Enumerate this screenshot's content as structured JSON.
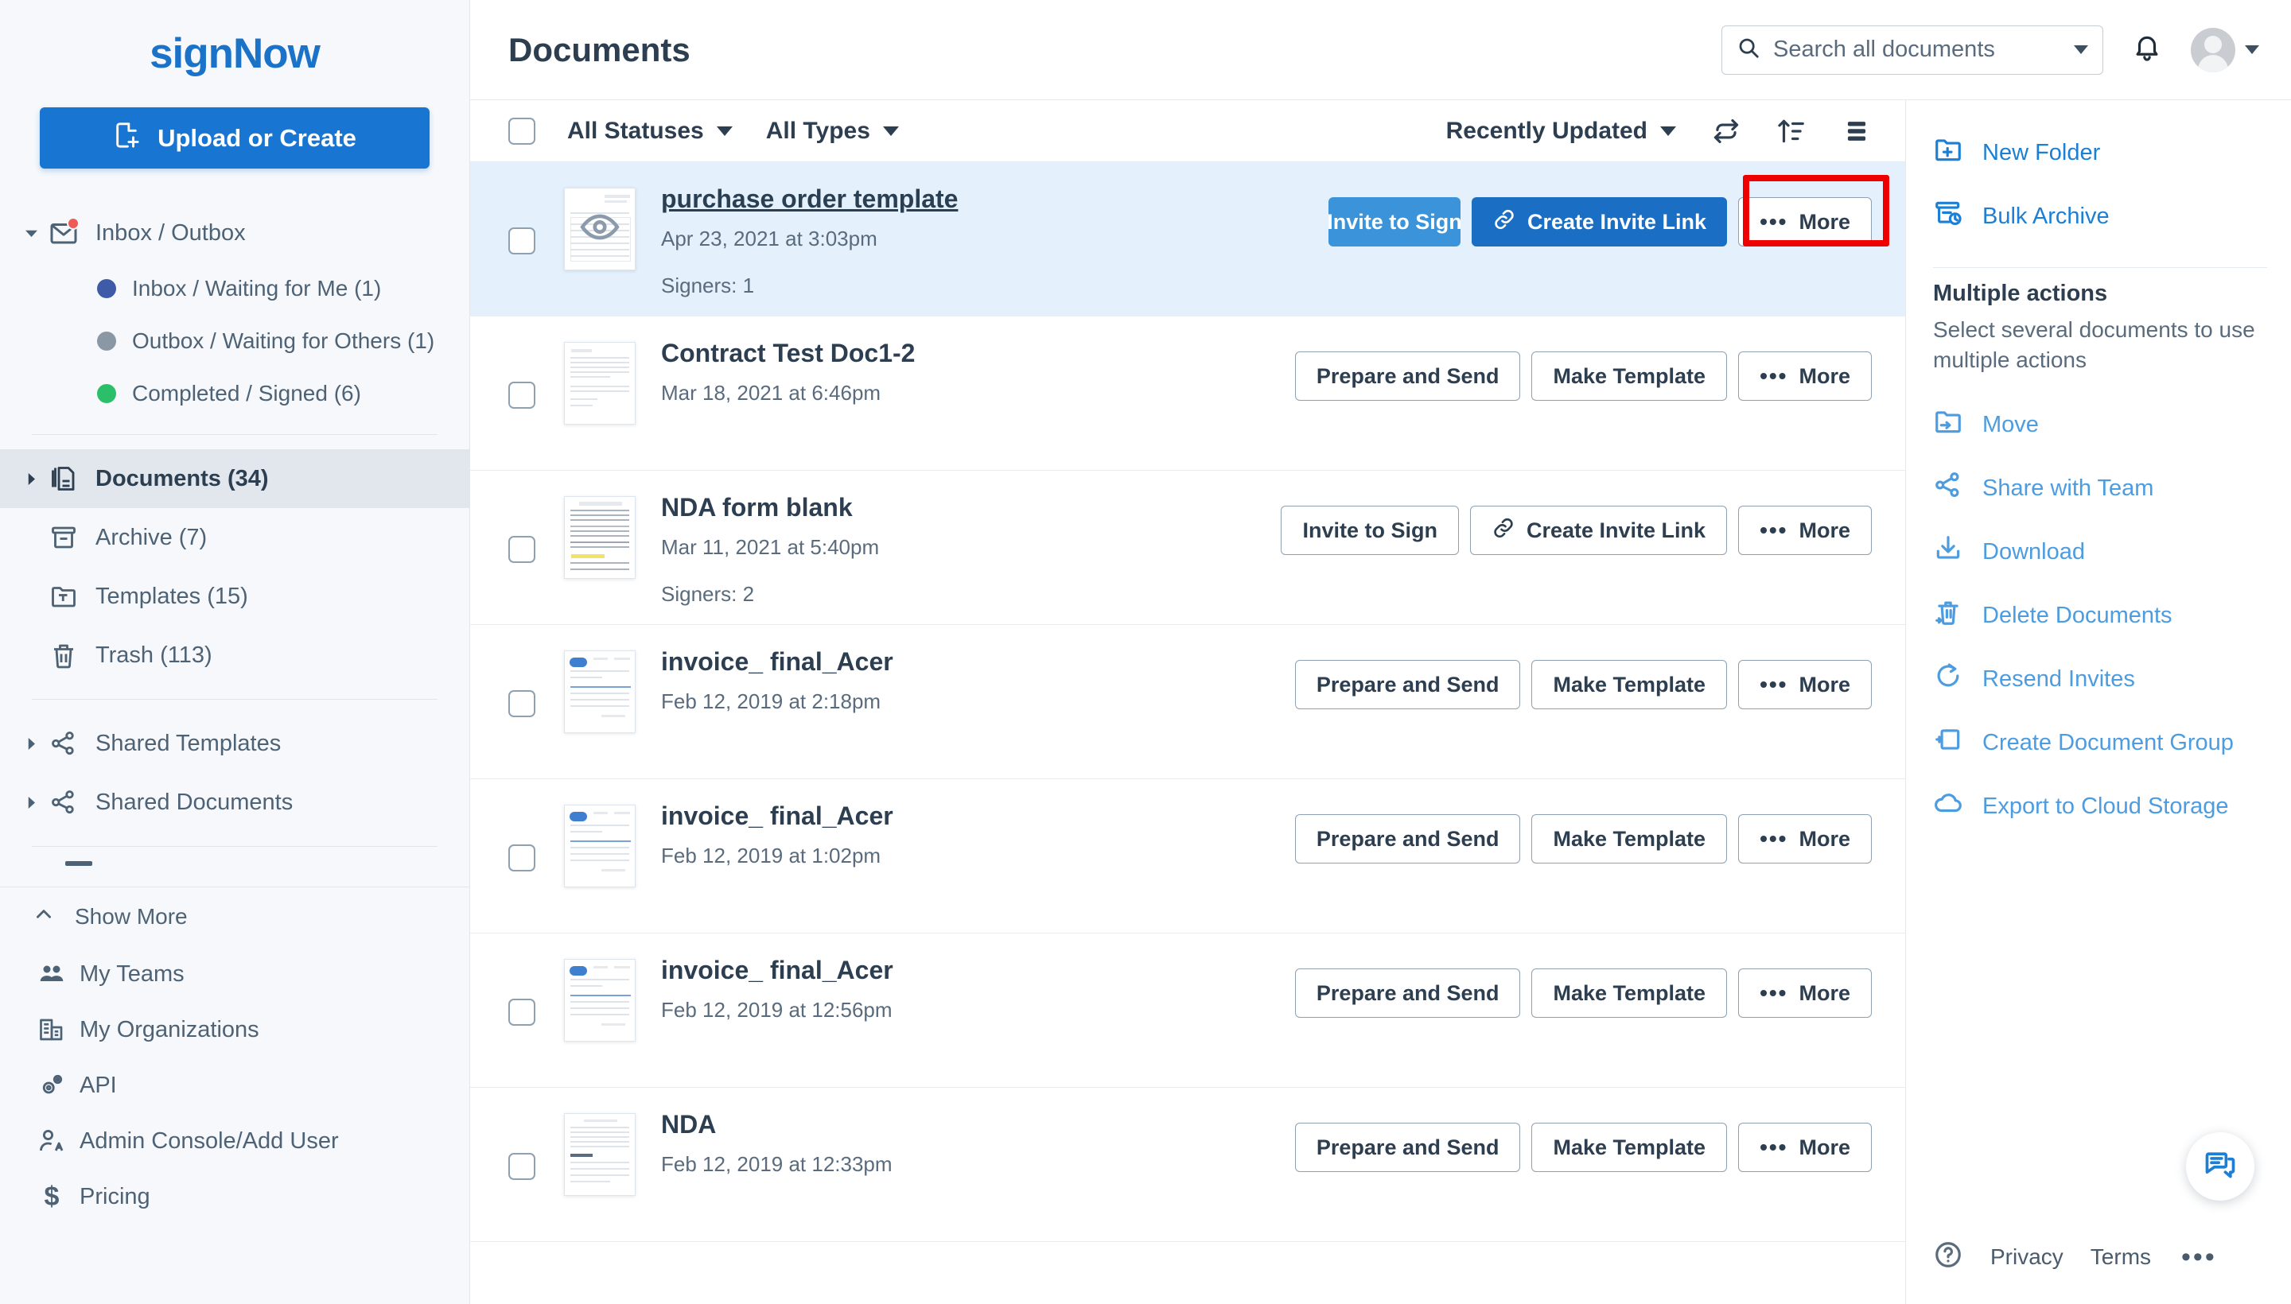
{
  "brand": {
    "name": "signNow",
    "accent": "#1876d2",
    "link_blue": "#1d7fd4",
    "highlight_red": "#ee0000"
  },
  "sidebar": {
    "upload_button": "Upload or Create",
    "inbox_group": {
      "label": "Inbox / Outbox",
      "has_notification": true
    },
    "status_items": [
      {
        "label": "Inbox / Waiting for Me (1)",
        "color": "#3f5aa6"
      },
      {
        "label": "Outbox / Waiting for Others (1)",
        "color": "#8a97a4"
      },
      {
        "label": "Completed / Signed (6)",
        "color": "#2cbf6a"
      }
    ],
    "folders": [
      {
        "label": "Documents (34)",
        "icon": "documents-icon",
        "active": true,
        "expandable": true
      },
      {
        "label": "Archive (7)",
        "icon": "archive-icon",
        "active": false,
        "expandable": false
      },
      {
        "label": "Templates (15)",
        "icon": "templates-icon",
        "active": false,
        "expandable": false
      },
      {
        "label": "Trash (113)",
        "icon": "trash-icon",
        "active": false,
        "expandable": false
      }
    ],
    "shared": [
      {
        "label": "Shared Templates",
        "icon": "share-template-icon"
      },
      {
        "label": "Shared Documents",
        "icon": "share-icon"
      }
    ],
    "show_more": "Show More",
    "more_items": [
      {
        "label": "My Teams",
        "icon": "teams-icon"
      },
      {
        "label": "My Organizations",
        "icon": "organizations-icon"
      },
      {
        "label": "API",
        "icon": "api-gear-icon"
      },
      {
        "label": "Admin Console/Add User",
        "icon": "admin-user-icon"
      },
      {
        "label": "Pricing",
        "icon": "dollar-icon"
      }
    ]
  },
  "header": {
    "title": "Documents",
    "search_placeholder": "Search all documents"
  },
  "filterbar": {
    "status_filter": "All Statuses",
    "type_filter": "All Types",
    "sort_label": "Recently Updated",
    "refresh_icon": "refresh-icon",
    "sort_icon": "sort-ascending-icon",
    "density_icon": "list-density-icon"
  },
  "documents": [
    {
      "name": "purchase order template",
      "date": "Apr 23, 2021 at 3:03pm",
      "signers": "Signers: 1",
      "selected": true,
      "name_link": true,
      "thumb": "purchase-order-thumbnail",
      "buttons": [
        {
          "label": "Invite to Sign",
          "style": "primary",
          "icon": null,
          "highlighted": true
        },
        {
          "label": "Create Invite Link",
          "style": "solid",
          "icon": "link-icon",
          "highlighted": false
        },
        {
          "label": "More",
          "style": "outline",
          "icon": "dots-icon",
          "highlighted": false
        }
      ]
    },
    {
      "name": "Contract Test Doc1-2",
      "date": "Mar 18, 2021 at 6:46pm",
      "signers": "",
      "selected": false,
      "name_link": false,
      "thumb": "contract-thumbnail",
      "buttons": [
        {
          "label": "Prepare and Send",
          "style": "outline",
          "icon": null,
          "highlighted": false
        },
        {
          "label": "Make Template",
          "style": "outline",
          "icon": null,
          "highlighted": false
        },
        {
          "label": "More",
          "style": "outline",
          "icon": "dots-icon",
          "highlighted": false
        }
      ]
    },
    {
      "name": "NDA form blank",
      "date": "Mar 11, 2021 at 5:40pm",
      "signers": "Signers: 2",
      "selected": false,
      "name_link": false,
      "thumb": "nda-form-thumbnail",
      "buttons": [
        {
          "label": "Invite to Sign",
          "style": "outline",
          "icon": null,
          "highlighted": false
        },
        {
          "label": "Create Invite Link",
          "style": "outline",
          "icon": "link-icon",
          "highlighted": false
        },
        {
          "label": "More",
          "style": "outline",
          "icon": "dots-icon",
          "highlighted": false
        }
      ]
    },
    {
      "name": "invoice_ final_Acer",
      "date": "Feb 12, 2019 at 2:18pm",
      "signers": "",
      "selected": false,
      "name_link": false,
      "thumb": "invoice-thumbnail",
      "buttons": [
        {
          "label": "Prepare and Send",
          "style": "outline",
          "icon": null,
          "highlighted": false
        },
        {
          "label": "Make Template",
          "style": "outline",
          "icon": null,
          "highlighted": false
        },
        {
          "label": "More",
          "style": "outline",
          "icon": "dots-icon",
          "highlighted": false
        }
      ]
    },
    {
      "name": "invoice_ final_Acer",
      "date": "Feb 12, 2019 at 1:02pm",
      "signers": "",
      "selected": false,
      "name_link": false,
      "thumb": "invoice-thumbnail",
      "buttons": [
        {
          "label": "Prepare and Send",
          "style": "outline",
          "icon": null,
          "highlighted": false
        },
        {
          "label": "Make Template",
          "style": "outline",
          "icon": null,
          "highlighted": false
        },
        {
          "label": "More",
          "style": "outline",
          "icon": "dots-icon",
          "highlighted": false
        }
      ]
    },
    {
      "name": "invoice_ final_Acer",
      "date": "Feb 12, 2019 at 12:56pm",
      "signers": "",
      "selected": false,
      "name_link": false,
      "thumb": "invoice-thumbnail",
      "buttons": [
        {
          "label": "Prepare and Send",
          "style": "outline",
          "icon": null,
          "highlighted": false
        },
        {
          "label": "Make Template",
          "style": "outline",
          "icon": null,
          "highlighted": false
        },
        {
          "label": "More",
          "style": "outline",
          "icon": "dots-icon",
          "highlighted": false
        }
      ]
    },
    {
      "name": "NDA",
      "date": "Feb 12, 2019 at 12:33pm",
      "signers": "",
      "selected": false,
      "name_link": false,
      "thumb": "nda-thumbnail",
      "buttons": [
        {
          "label": "Prepare and Send",
          "style": "outline",
          "icon": null,
          "highlighted": false
        },
        {
          "label": "Make Template",
          "style": "outline",
          "icon": null,
          "highlighted": false
        },
        {
          "label": "More",
          "style": "outline",
          "icon": "dots-icon",
          "highlighted": false
        }
      ]
    }
  ],
  "rightpanel": {
    "top_links": [
      {
        "label": "New Folder",
        "icon": "new-folder-icon"
      },
      {
        "label": "Bulk Archive",
        "icon": "bulk-archive-icon"
      }
    ],
    "multiple_actions_title": "Multiple actions",
    "multiple_actions_hint": "Select several documents to use multiple actions",
    "actions": [
      {
        "label": "Move",
        "icon": "move-icon"
      },
      {
        "label": "Share with Team",
        "icon": "share-icon"
      },
      {
        "label": "Download",
        "icon": "download-icon"
      },
      {
        "label": "Delete Documents",
        "icon": "delete-icon"
      },
      {
        "label": "Resend Invites",
        "icon": "resend-icon"
      },
      {
        "label": "Create Document Group",
        "icon": "document-group-icon"
      },
      {
        "label": "Export to Cloud Storage",
        "icon": "cloud-icon"
      }
    ],
    "footer": {
      "privacy": "Privacy",
      "terms": "Terms",
      "more": "•••",
      "help_icon": "help-circle-icon",
      "chat_icon": "chat-icon"
    }
  }
}
